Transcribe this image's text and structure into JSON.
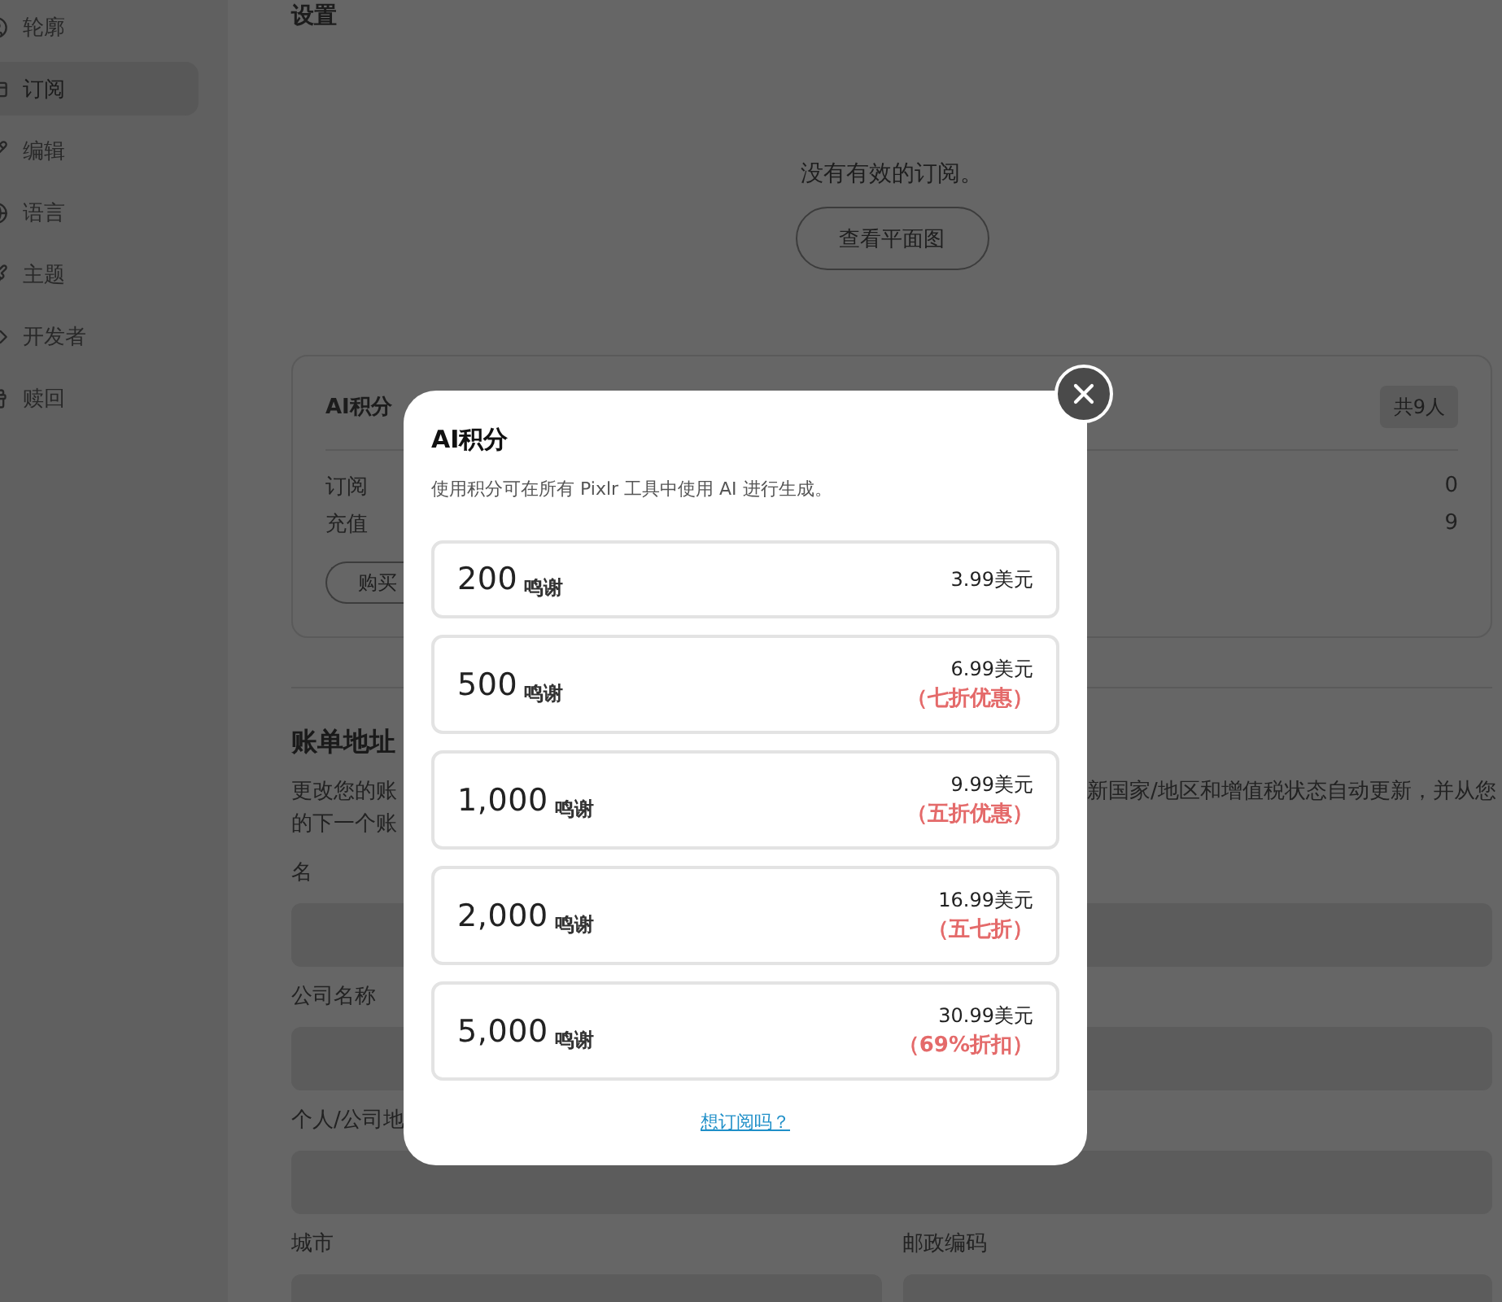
{
  "sidebar": {
    "items": [
      {
        "label": "轮廓",
        "selected": false
      },
      {
        "label": "订阅",
        "selected": true
      },
      {
        "label": "编辑",
        "selected": false
      },
      {
        "label": "语言",
        "selected": false
      },
      {
        "label": "主题",
        "selected": false
      },
      {
        "label": "开发者",
        "selected": false
      },
      {
        "label": "赎回",
        "selected": false
      }
    ]
  },
  "page": {
    "title": "设置"
  },
  "subscription": {
    "message": "没有有效的订阅。",
    "button": "查看平面图"
  },
  "credits_card": {
    "title": "AI积分",
    "badge": "共9人",
    "rows": [
      {
        "label": "订阅",
        "value": "0"
      },
      {
        "label": "充值",
        "value": "9"
      }
    ],
    "button": "购买"
  },
  "billing": {
    "title": "账单地址",
    "description_left": [
      "更改您的账",
      "的下一个账"
    ],
    "description_right": [
      "新国家/地区和增值税状态自动更新，并从您"
    ],
    "field_rows": [
      [
        {
          "label": "名"
        }
      ],
      [
        {
          "label": "公司名称"
        }
      ],
      [
        {
          "label": "个人/公司地"
        }
      ],
      [
        {
          "label": "城市"
        },
        {
          "label": "邮政编码"
        }
      ]
    ]
  },
  "dialog": {
    "title": "AI积分",
    "description": "使用积分可在所有 Pixlr 工具中使用 AI 进行生成。",
    "options": [
      {
        "amount": "200",
        "unit": "鸣谢",
        "price": "3.99美元"
      },
      {
        "amount": "500",
        "unit": "鸣谢",
        "price": "6.99美元",
        "discount": "（七折优惠）"
      },
      {
        "amount": "1,000",
        "unit": "鸣谢",
        "price": "9.99美元",
        "discount": "（五折优惠）"
      },
      {
        "amount": "2,000",
        "unit": "鸣谢",
        "price": "16.99美元",
        "discount": "（五七折）"
      },
      {
        "amount": "5,000",
        "unit": "鸣谢",
        "price": "30.99美元",
        "discount": "（69%折扣）"
      }
    ],
    "link": "想订阅吗？"
  }
}
